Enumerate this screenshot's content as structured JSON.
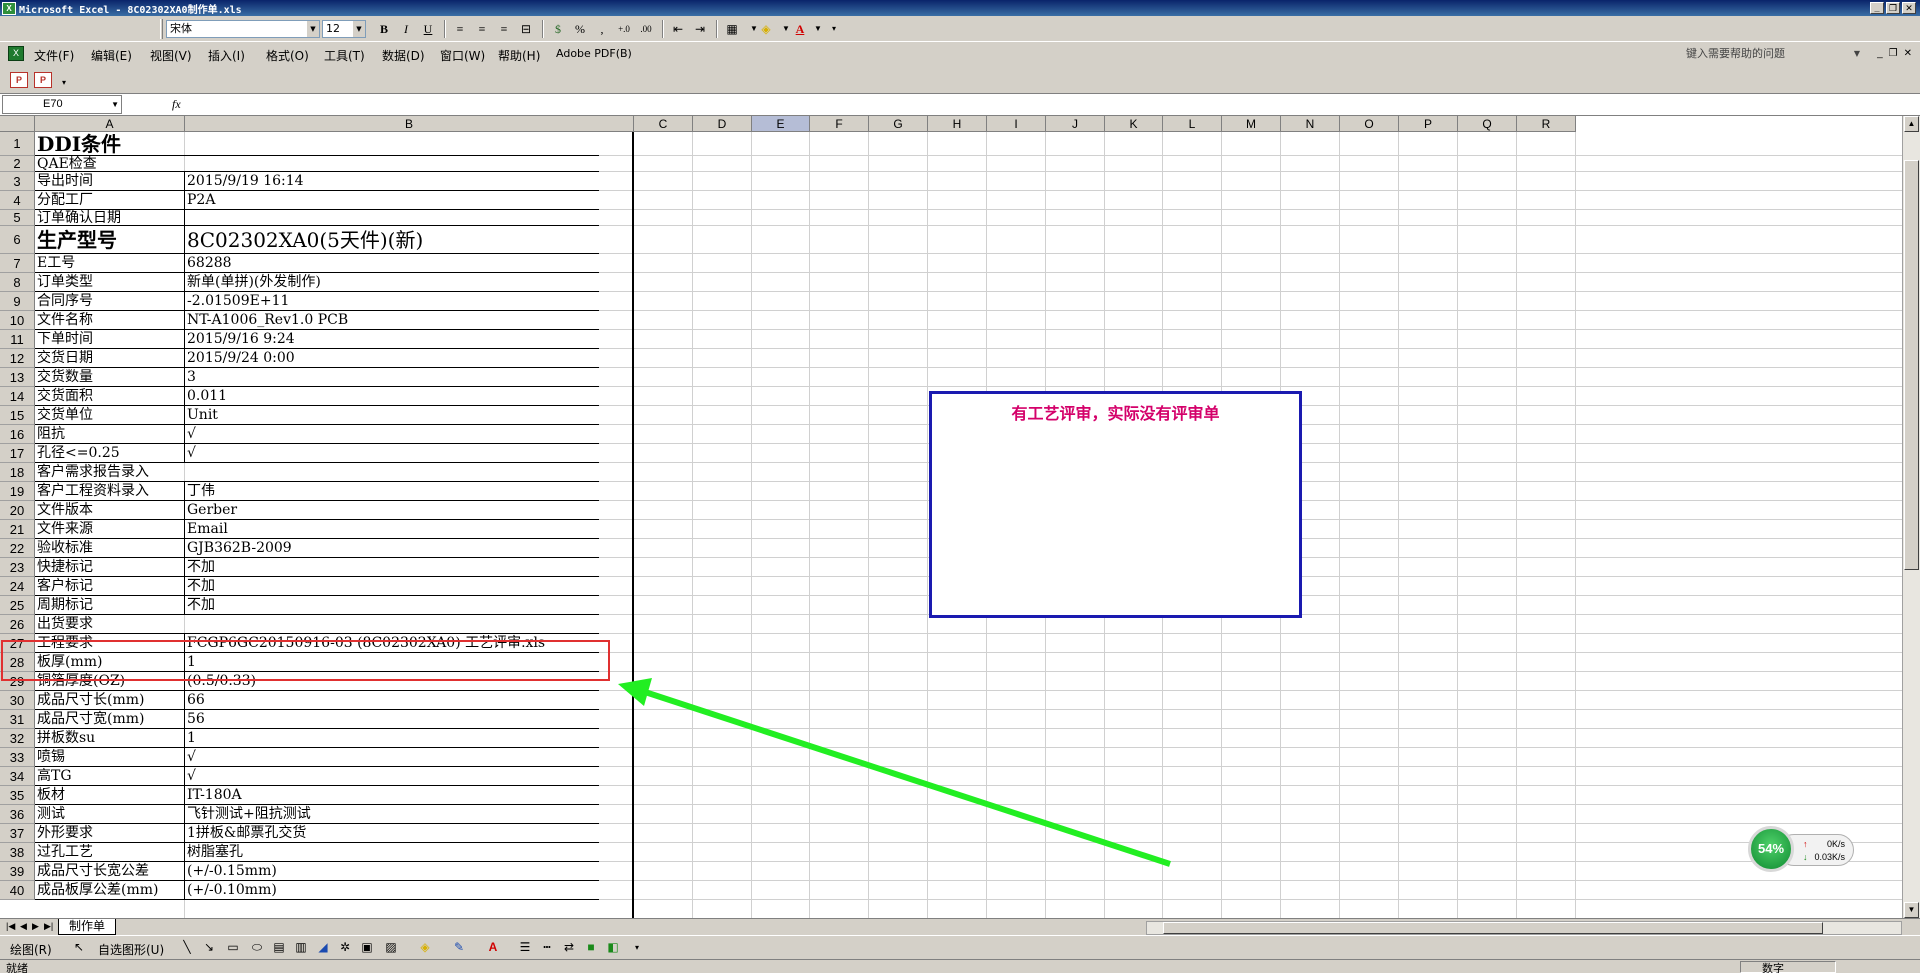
{
  "window": {
    "title": "Microsoft Excel - 8C02302XA0制作单.xls",
    "app_icon": "excel-icon"
  },
  "format_toolbar": {
    "font_name": "宋体",
    "font_size": "12",
    "bold": "B",
    "italic": "I",
    "underline": "U",
    "percent": "%",
    "comma": ","
  },
  "menu": {
    "items": [
      "文件(F)",
      "编辑(E)",
      "视图(V)",
      "插入(I)",
      "格式(O)",
      "工具(T)",
      "数据(D)",
      "窗口(W)",
      "帮助(H)",
      "Adobe PDF(B)"
    ],
    "help_placeholder": "键入需要帮助的问题"
  },
  "formula_bar": {
    "name_box": "E70",
    "fx": "fx",
    "content": ""
  },
  "columns": [
    "A",
    "B",
    "C",
    "D",
    "E",
    "F",
    "G",
    "H",
    "I",
    "J",
    "K",
    "L",
    "M",
    "N",
    "O",
    "P",
    "Q",
    "R"
  ],
  "active_column": "E",
  "rows": [
    {
      "n": "1",
      "a": "DDI条件",
      "b": ""
    },
    {
      "n": "2",
      "a": "QAE检查",
      "b": ""
    },
    {
      "n": "3",
      "a": "导出时间",
      "b": "2015/9/19 16:14"
    },
    {
      "n": "4",
      "a": "分配工厂",
      "b": "P2A"
    },
    {
      "n": "5",
      "a": "订单确认日期",
      "b": ""
    },
    {
      "n": "6",
      "a": "生产型号",
      "b": "8C02302XA0(5天件)(新)"
    },
    {
      "n": "7",
      "a": "E工号",
      "b": "68288"
    },
    {
      "n": "8",
      "a": "订单类型",
      "b": "新单(单拼)(外发制作)"
    },
    {
      "n": "9",
      "a": "合同序号",
      "b": "-2.01509E+11"
    },
    {
      "n": "10",
      "a": "文件名称",
      "b": "NT-A1006_Rev1.0 PCB"
    },
    {
      "n": "11",
      "a": "下单时间",
      "b": "2015/9/16 9:24"
    },
    {
      "n": "12",
      "a": "交货日期",
      "b": "2015/9/24 0:00"
    },
    {
      "n": "13",
      "a": "交货数量",
      "b": "3"
    },
    {
      "n": "14",
      "a": "交货面积",
      "b": "0.011"
    },
    {
      "n": "15",
      "a": "交货单位",
      "b": "Unit"
    },
    {
      "n": "16",
      "a": "阻抗",
      "b": "√"
    },
    {
      "n": "17",
      "a": "孔径<=0.25",
      "b": "√"
    },
    {
      "n": "18",
      "a": "客户需求报告录入",
      "b": ""
    },
    {
      "n": "19",
      "a": "客户工程资料录入",
      "b": "丁伟"
    },
    {
      "n": "20",
      "a": "文件版本",
      "b": "Gerber"
    },
    {
      "n": "21",
      "a": "文件来源",
      "b": "Email"
    },
    {
      "n": "22",
      "a": "验收标准",
      "b": "GJB362B-2009"
    },
    {
      "n": "23",
      "a": "快捷标记",
      "b": "不加"
    },
    {
      "n": "24",
      "a": "客户标记",
      "b": "不加"
    },
    {
      "n": "25",
      "a": "周期标记",
      "b": "不加"
    },
    {
      "n": "26",
      "a": "出货要求",
      "b": ""
    },
    {
      "n": "27",
      "a": "工程要求",
      "b": "FCGP6GC20150916-03 (8C02302XA0) 工艺评审.xls"
    },
    {
      "n": "28",
      "a": "板厚(mm)",
      "b": "1"
    },
    {
      "n": "29",
      "a": "铜箔厚度(OZ)",
      "b": "(0.5/0.33)"
    },
    {
      "n": "30",
      "a": "成品尺寸长(mm)",
      "b": "66"
    },
    {
      "n": "31",
      "a": "成品尺寸宽(mm)",
      "b": "56"
    },
    {
      "n": "32",
      "a": "拼板数su",
      "b": "1"
    },
    {
      "n": "33",
      "a": "喷锡",
      "b": "√"
    },
    {
      "n": "34",
      "a": "高TG",
      "b": "√"
    },
    {
      "n": "35",
      "a": "板材",
      "b": "IT-180A"
    },
    {
      "n": "36",
      "a": "测试",
      "b": "飞针测试+阻抗测试"
    },
    {
      "n": "37",
      "a": "外形要求",
      "b": "1拼板&邮票孔交货"
    },
    {
      "n": "38",
      "a": "过孔工艺",
      "b": "树脂塞孔"
    },
    {
      "n": "39",
      "a": "成品尺寸长宽公差",
      "b": "(+/-0.15mm)"
    },
    {
      "n": "40",
      "a": "成品板厚公差(mm)",
      "b": "(+/-0.10mm)"
    }
  ],
  "annotation": {
    "text": "有工艺评审，实际没有评审单",
    "text_color": "#d4006a",
    "border_color": "#1a1ab0",
    "highlight_color": "#e03030",
    "arrow_color": "#22ee22"
  },
  "sheet_tabs": [
    "制作单"
  ],
  "draw_toolbar": {
    "draw_label": "绘图(R)",
    "autoshapes_label": "自选图形(U)"
  },
  "status": {
    "left": "就绪",
    "right": "数字"
  },
  "net_widget": {
    "percent": "54%",
    "up_speed": "0K/s",
    "down_speed": "0.03K/s"
  }
}
